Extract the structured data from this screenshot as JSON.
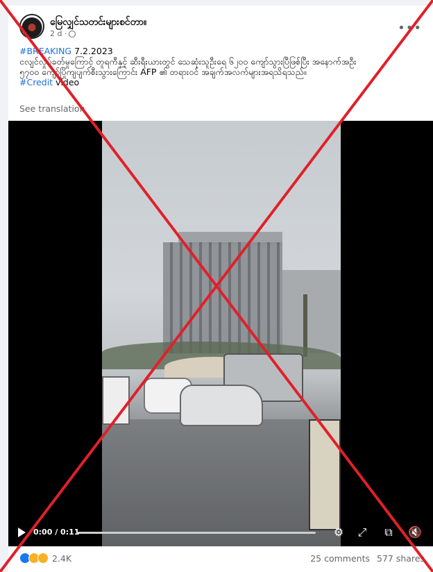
{
  "post": {
    "page_name": "မြေလျှင်သတင်းများစင်တာ။",
    "time": "2 d ·",
    "text_line1_tag": "#BREAKING",
    "text_line1_date": " 7.2.2023",
    "text_line2": "ငလျင်လှုပ်ခတ်မှုကြောင့် တူရကီနှင့် ဆီးရီးယားတွင် သေဆုံးသူဦးရေ ၆၂၀၀ ကျော်သွားပြီဖြစ်ပြီး အနောက်အဦး",
    "text_line3": "၅၇၀၀ ကျော်ပြိုကျပျက်စီးသွားကြောင်း AFP ၏ တရားဝင် အချက်အလက်များအရသိရသည်။",
    "credit_tag": "#Credit",
    "credit_text": " video",
    "see_translation": "See translation"
  },
  "video": {
    "time": "0:00 / 0:11",
    "progress": 0
  },
  "footer": {
    "reaction_count": "2.4K",
    "comments": "25 comments",
    "shares": "577 shares"
  },
  "icons": {
    "more": "more-icon",
    "globe": "globe-icon",
    "play": "play-icon",
    "settings": "gear-icon",
    "fullscreen_expand": "expand-icon",
    "pip": "picture-in-picture-icon",
    "mute": "mute-icon"
  },
  "colors": {
    "hashtag": "#216fdb",
    "overlay_x": "#e0202a"
  }
}
